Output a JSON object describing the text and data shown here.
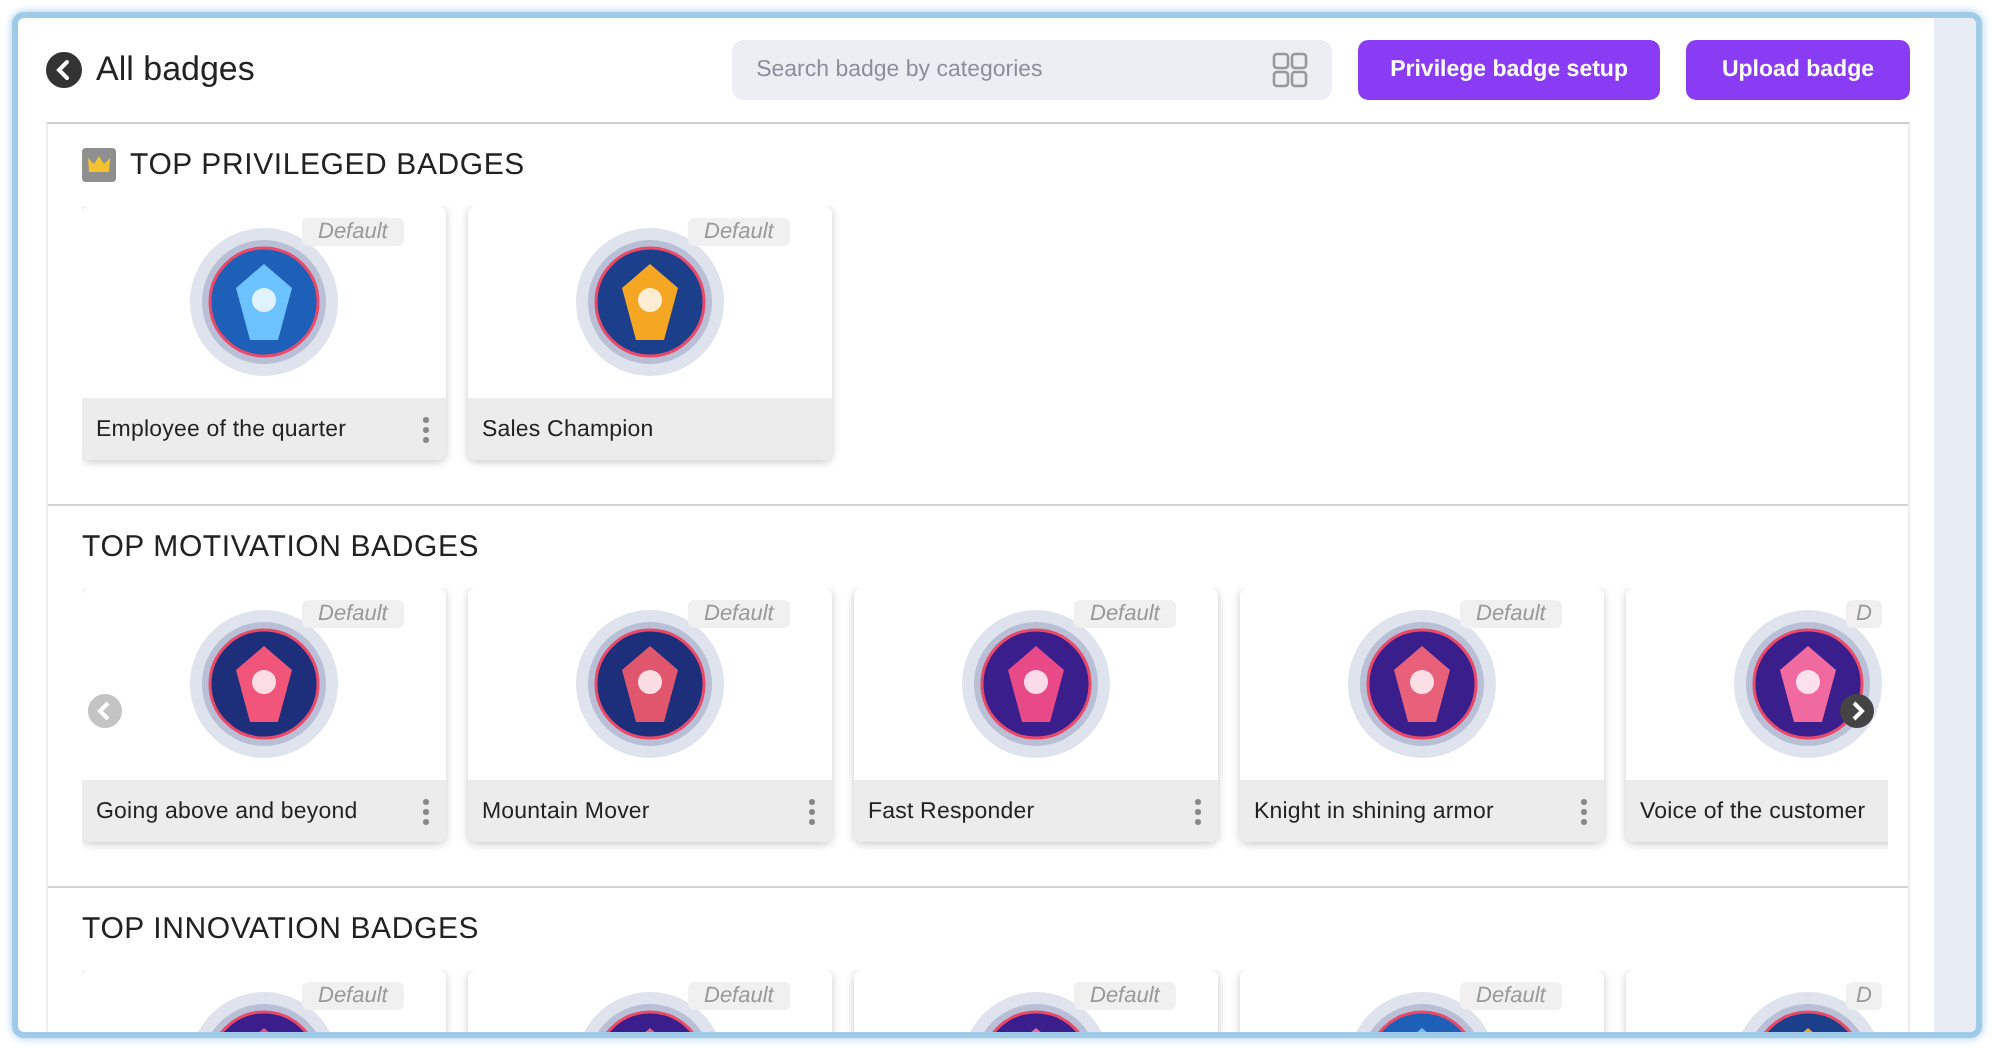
{
  "header": {
    "title": "All badges",
    "search": {
      "placeholder": "Search badge by categories"
    },
    "buttons": [
      "Privilege badge setup",
      "Upload badge"
    ]
  },
  "sections": [
    {
      "title": "TOP PRIVILEGED BADGES",
      "crown": true,
      "carousel": false,
      "cards": [
        {
          "tag": "Default",
          "name": "Employee of the quarter"
        },
        {
          "tag": "Default",
          "name": "Sales Champion"
        }
      ]
    },
    {
      "title": "TOP MOTIVATION BADGES",
      "crown": false,
      "carousel": true,
      "cards": [
        {
          "tag": "Default",
          "name": "Going above and beyond"
        },
        {
          "tag": "Default",
          "name": "Mountain Mover"
        },
        {
          "tag": "Default",
          "name": "Fast Responder"
        },
        {
          "tag": "Default",
          "name": "Knight in shining armor"
        },
        {
          "tag": "D",
          "name": "Voice of the customer"
        }
      ]
    },
    {
      "title": "TOP INNOVATION BADGES",
      "crown": false,
      "carousel": false,
      "cards": [
        {
          "tag": "Default"
        },
        {
          "tag": "Default"
        },
        {
          "tag": "Default"
        },
        {
          "tag": "Default"
        },
        {
          "tag": "D"
        }
      ]
    }
  ]
}
